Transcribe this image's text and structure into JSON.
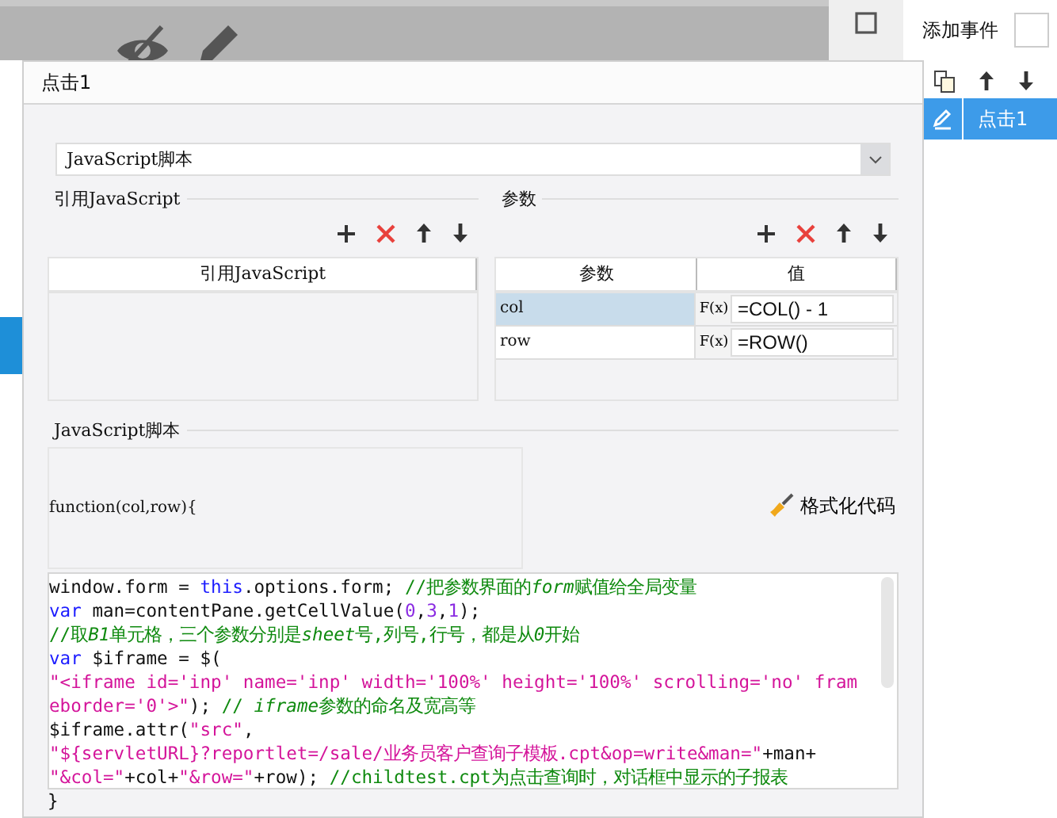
{
  "background": {
    "panel_title": "添加事件"
  },
  "events_panel": {
    "items": [
      {
        "label": "点击1",
        "selected": true
      }
    ]
  },
  "dialog": {
    "title": "点击1",
    "type_select": "JavaScript脚本",
    "references": {
      "title": "引用JavaScript",
      "column": "引用JavaScript"
    },
    "parameters": {
      "title": "参数",
      "columns": [
        "参数",
        "值"
      ],
      "rows": [
        {
          "name": "col",
          "function_button": "F(x)",
          "value": "=COL() - 1",
          "selected": true
        },
        {
          "name": "row",
          "function_button": "F(x)",
          "value": "=ROW()",
          "selected": false
        }
      ]
    },
    "script": {
      "title": "JavaScript脚本",
      "signature": "function(col,row){",
      "format_button": "格式化代码",
      "lines": [
        [
          {
            "kind": "plain",
            "text": "window.form = "
          },
          {
            "kind": "keyword",
            "text": "this"
          },
          {
            "kind": "plain",
            "text": ".options.form; "
          },
          {
            "kind": "comment",
            "text": "//把参数界面的"
          },
          {
            "kind": "comment_em",
            "text": "form"
          },
          {
            "kind": "comment",
            "text": "赋值给全局变量"
          }
        ],
        [
          {
            "kind": "keyword",
            "text": "var"
          },
          {
            "kind": "plain",
            "text": " man=contentPane.getCellValue("
          },
          {
            "kind": "number",
            "text": "0"
          },
          {
            "kind": "plain",
            "text": ","
          },
          {
            "kind": "number",
            "text": "3"
          },
          {
            "kind": "plain",
            "text": ","
          },
          {
            "kind": "number",
            "text": "1"
          },
          {
            "kind": "plain",
            "text": ");"
          }
        ],
        [
          {
            "kind": "comment",
            "text": "//取"
          },
          {
            "kind": "comment_em",
            "text": "B1"
          },
          {
            "kind": "comment",
            "text": "单元格，三个参数分别是"
          },
          {
            "kind": "comment_em",
            "text": "sheet"
          },
          {
            "kind": "comment",
            "text": "号,列号,行号，都是从"
          },
          {
            "kind": "comment_em",
            "text": "0"
          },
          {
            "kind": "comment",
            "text": "开始"
          }
        ],
        [
          {
            "kind": "keyword",
            "text": "var"
          },
          {
            "kind": "plain",
            "text": " $iframe = $("
          }
        ],
        [
          {
            "kind": "string",
            "text": "\"<iframe id='inp' name='inp' width='100%' height='100%' scrolling='no' fram"
          }
        ],
        [
          {
            "kind": "string",
            "text": "eborder='0'>\""
          },
          {
            "kind": "plain",
            "text": "); "
          },
          {
            "kind": "comment",
            "text": "// "
          },
          {
            "kind": "comment_em",
            "text": "iframe"
          },
          {
            "kind": "comment",
            "text": "参数的命名及宽高等"
          }
        ],
        [
          {
            "kind": "plain",
            "text": "$iframe.attr("
          },
          {
            "kind": "string",
            "text": "\"src\""
          },
          {
            "kind": "plain",
            "text": ","
          }
        ],
        [
          {
            "kind": "string",
            "text": "\"${servletURL}?reportlet=/sale/业务员客户查询子模板.cpt&op=write&man=\""
          },
          {
            "kind": "plain",
            "text": "+man+"
          }
        ],
        [
          {
            "kind": "string",
            "text": "\"&col=\""
          },
          {
            "kind": "plain",
            "text": "+col+"
          },
          {
            "kind": "string",
            "text": "\"&row=\""
          },
          {
            "kind": "plain",
            "text": "+row); "
          },
          {
            "kind": "comment",
            "text": "//childtest.cpt为点击查询时，对话框中显示的子报表"
          }
        ]
      ],
      "closing": "}"
    }
  }
}
